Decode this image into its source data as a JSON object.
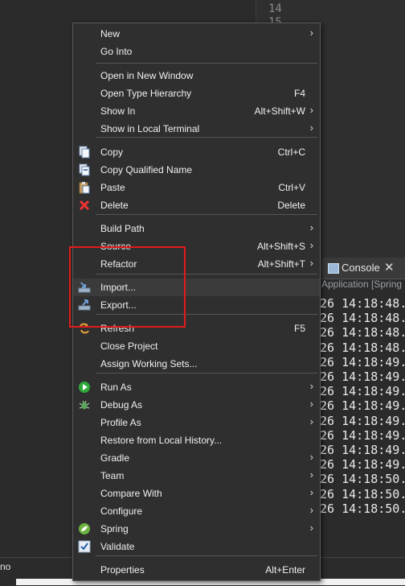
{
  "editor": {
    "line_numbers": [
      "14",
      "15"
    ]
  },
  "console": {
    "tab_label": "Console",
    "close_glyph": "✕",
    "subtitle": "Application [Spring",
    "lines": [
      "26 14:18:48.",
      "26 14:18:48.",
      "26 14:18:48.",
      "26 14:18:48.",
      "26 14:18:49.",
      "26 14:18:49.",
      "26 14:18:49.",
      "26 14:18:49.",
      "26 14:18:49.",
      "26 14:18:49.",
      "26 14:18:49.",
      "26 14:18:49.",
      "26 14:18:50.",
      "26 14:18:50.",
      "26 14:18:50."
    ]
  },
  "status": {
    "left_text": "no"
  },
  "menu": {
    "items": [
      {
        "label": "New",
        "shortcut": "",
        "submenu": true,
        "icon": ""
      },
      {
        "label": "Go Into",
        "shortcut": "",
        "submenu": false,
        "icon": ""
      },
      {
        "label": "Open in New Window",
        "shortcut": "",
        "submenu": false,
        "icon": ""
      },
      {
        "label": "Open Type Hierarchy",
        "shortcut": "F4",
        "submenu": false,
        "icon": ""
      },
      {
        "label": "Show In",
        "shortcut": "Alt+Shift+W",
        "submenu": true,
        "icon": ""
      },
      {
        "label": "Show in Local Terminal",
        "shortcut": "",
        "submenu": true,
        "icon": ""
      },
      {
        "label": "Copy",
        "shortcut": "Ctrl+C",
        "submenu": false,
        "icon": "copy-icon"
      },
      {
        "label": "Copy Qualified Name",
        "shortcut": "",
        "submenu": false,
        "icon": "copy-qualified-icon"
      },
      {
        "label": "Paste",
        "shortcut": "Ctrl+V",
        "submenu": false,
        "icon": "paste-icon"
      },
      {
        "label": "Delete",
        "shortcut": "Delete",
        "submenu": false,
        "icon": "delete-icon"
      },
      {
        "label": "Build Path",
        "shortcut": "",
        "submenu": true,
        "icon": ""
      },
      {
        "label": "Source",
        "shortcut": "Alt+Shift+S",
        "submenu": true,
        "icon": ""
      },
      {
        "label": "Refactor",
        "shortcut": "Alt+Shift+T",
        "submenu": true,
        "icon": ""
      },
      {
        "label": "Import...",
        "shortcut": "",
        "submenu": false,
        "icon": "import-icon"
      },
      {
        "label": "Export...",
        "shortcut": "",
        "submenu": false,
        "icon": "export-icon"
      },
      {
        "label": "Refresh",
        "shortcut": "F5",
        "submenu": false,
        "icon": "refresh-icon"
      },
      {
        "label": "Close Project",
        "shortcut": "",
        "submenu": false,
        "icon": ""
      },
      {
        "label": "Assign Working Sets...",
        "shortcut": "",
        "submenu": false,
        "icon": ""
      },
      {
        "label": "Run As",
        "shortcut": "",
        "submenu": true,
        "icon": "run-icon"
      },
      {
        "label": "Debug As",
        "shortcut": "",
        "submenu": true,
        "icon": "debug-icon"
      },
      {
        "label": "Profile As",
        "shortcut": "",
        "submenu": true,
        "icon": ""
      },
      {
        "label": "Restore from Local History...",
        "shortcut": "",
        "submenu": false,
        "icon": ""
      },
      {
        "label": "Gradle",
        "shortcut": "",
        "submenu": true,
        "icon": ""
      },
      {
        "label": "Team",
        "shortcut": "",
        "submenu": true,
        "icon": ""
      },
      {
        "label": "Compare With",
        "shortcut": "",
        "submenu": true,
        "icon": ""
      },
      {
        "label": "Configure",
        "shortcut": "",
        "submenu": true,
        "icon": ""
      },
      {
        "label": "Spring",
        "shortcut": "",
        "submenu": true,
        "icon": "spring-icon"
      },
      {
        "label": "Validate",
        "shortcut": "",
        "submenu": false,
        "icon": "validate-icon"
      },
      {
        "label": "Properties",
        "shortcut": "Alt+Enter",
        "submenu": false,
        "icon": ""
      }
    ],
    "submenu_glyph": "›",
    "highlighted_label": "Import..."
  },
  "colors": {
    "menu_bg": "#2f2f2f",
    "highlight_bg": "#3b3b3b",
    "annotation_red": "#e11b1b",
    "run_green": "#2fa83a",
    "delete_red": "#e33"
  }
}
